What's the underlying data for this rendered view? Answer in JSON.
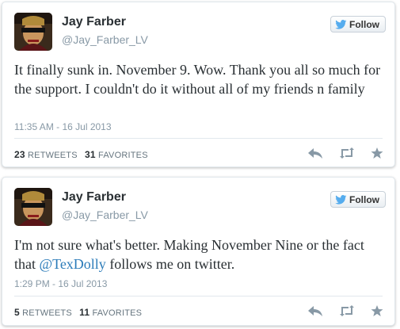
{
  "colors": {
    "link": "#2b7bb9",
    "muted": "#8899a6",
    "text": "#292f33",
    "action_icon": "#8899a6",
    "follow_bird": "#55acee"
  },
  "tweets": [
    {
      "name": "Jay Farber",
      "handle": "@Jay_Farber_LV",
      "follow_label": "Follow",
      "text_parts": [
        "It finally sunk in. November 9. Wow. Thank you all so much for the support. I couldn't do it without all of my friends n family"
      ],
      "timestamp": "11:35 AM - 16 Jul 2013",
      "retweets": "23",
      "retweets_label": "RETWEETS",
      "favorites": "31",
      "favorites_label": "FAVORITES",
      "actions": [
        "reply-icon",
        "retweet-icon",
        "favorite-icon"
      ]
    },
    {
      "name": "Jay Farber",
      "handle": "@Jay_Farber_LV",
      "follow_label": "Follow",
      "text_parts": [
        "I'm not sure what's better. Making November Nine or the fact that ",
        "@TexDolly",
        " follows me on twitter."
      ],
      "timestamp": "1:29 PM - 16 Jul 2013",
      "retweets": "5",
      "retweets_label": "RETWEETS",
      "favorites": "11",
      "favorites_label": "FAVORITES",
      "actions": [
        "reply-icon",
        "retweet-icon",
        "favorite-icon"
      ]
    }
  ]
}
